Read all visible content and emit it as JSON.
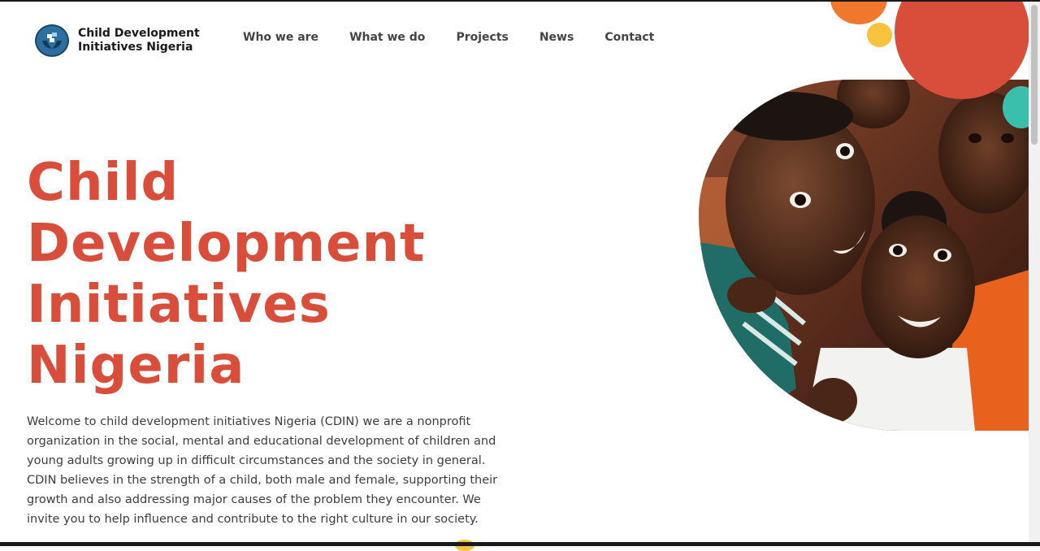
{
  "brand": {
    "line1": "Child Development",
    "line2": "Initiatives Nigeria",
    "logo_icon": "hands-holding-figures-icon"
  },
  "nav": {
    "items": [
      {
        "label": "Who we are"
      },
      {
        "label": "What we do"
      },
      {
        "label": "Projects"
      },
      {
        "label": "News"
      },
      {
        "label": "Contact"
      }
    ]
  },
  "hero": {
    "title_lines": [
      "Child",
      "Development",
      "Initiatives",
      "Nigeria"
    ],
    "body": "Welcome to child development initiatives Nigeria (CDIN) we are a nonprofit organization in the social, mental and educational development of children and young adults growing up in difficult circumstances and the society in general. CDIN believes in the strength of a child, both male and female, supporting their growth and also addressing major causes of the problem they encounter. We invite you to help influence and contribute to the right culture in our society.",
    "image": "smiling-children-photo"
  },
  "colors": {
    "accent": "#d94e3b",
    "orange": "#f0772b",
    "yellow": "#f8c23e",
    "teal": "#3bbfad",
    "body_text": "#3d3d3d"
  }
}
